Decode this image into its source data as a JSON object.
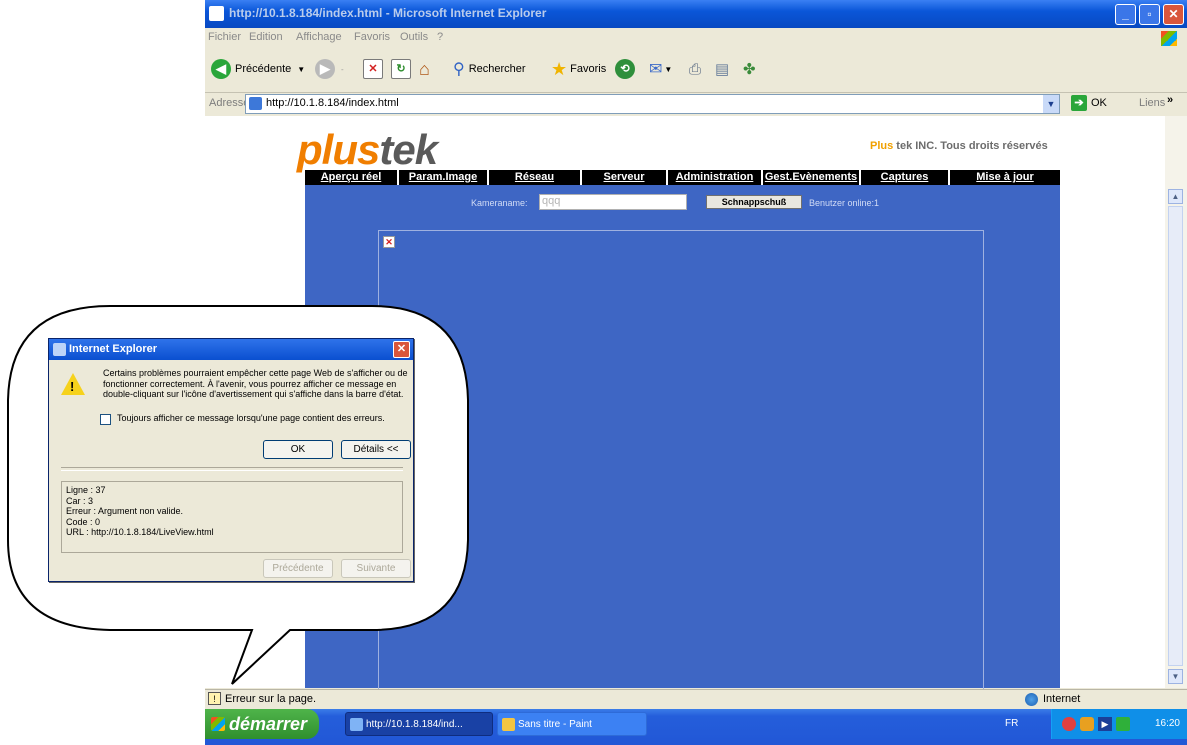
{
  "window": {
    "title": "http://10.1.8.184/index.html - Microsoft Internet Explorer"
  },
  "menu": [
    "Fichier",
    "Edition",
    "Affichage",
    "Favoris",
    "Outils",
    "?"
  ],
  "toolbar": {
    "back_label": "Précédente",
    "search_label": "Rechercher",
    "favorites_label": "Favoris"
  },
  "address": {
    "label": "Adresse",
    "url": "http://10.1.8.184/index.html",
    "go_label": "OK",
    "links_label": "Liens"
  },
  "page": {
    "logo_part1": "plus",
    "logo_part2": "tek",
    "copyright_brand": "Plus",
    "copyright_rest": "tek INC. Tous droits réservés",
    "nav": [
      "Aperçu réel",
      "Param.Image",
      "Réseau",
      "Serveur",
      "Administration",
      "Gest.Evènements",
      "Captures",
      "Mise à jour"
    ],
    "camera_label": "Kameraname:",
    "camera_value": "qqq",
    "snapshot_label": "Schnappschuß",
    "online_text": "Benutzer online:1"
  },
  "status": {
    "text": "Erreur sur la page.",
    "zone": "Internet"
  },
  "taskbar": {
    "start_label": "démarrer",
    "tasks": [
      "http://10.1.8.184/ind...",
      "Sans titre - Paint"
    ],
    "language": "FR",
    "clock": "16:20"
  },
  "dialog": {
    "title": "Internet Explorer",
    "message": "Certains problèmes pourraient empêcher cette page Web de s'afficher ou de fonctionner correctement. À l'avenir, vous pourrez afficher ce message en double-cliquant sur l'icône d'avertissement qui s'affiche dans la barre d'état.",
    "checkbox_label": "Toujours afficher ce message lorsqu'une page contient des erreurs.",
    "ok_label": "OK",
    "details_label": "Détails <<",
    "details": {
      "line": "Ligne : 37",
      "char": "Car :   3",
      "error": "Erreur : Argument non valide.",
      "code": "Code : 0",
      "url": "URL :   http://10.1.8.184/LiveView.html"
    },
    "prev_label": "Précédente",
    "next_label": "Suivante"
  }
}
